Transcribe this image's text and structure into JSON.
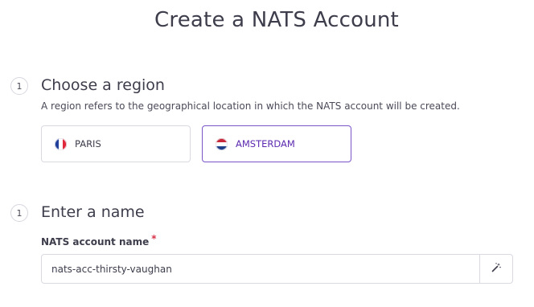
{
  "page": {
    "title": "Create a NATS Account"
  },
  "region_step": {
    "number": "1",
    "title": "Choose a region",
    "description": "A region refers to the geographical location in which the NATS account will be created.",
    "options": [
      {
        "label": "PARIS",
        "flag": "flag-france-icon",
        "selected": false
      },
      {
        "label": "AMSTERDAM",
        "flag": "flag-netherlands-icon",
        "selected": true
      }
    ]
  },
  "name_step": {
    "number": "1",
    "title": "Enter a name",
    "field_label": "NATS account name",
    "required_marker": "*",
    "value": "nats-acc-thirsty-vaughan",
    "generate_icon": "magic-wand-icon"
  },
  "colors": {
    "accent": "#7b54c9",
    "selected_text": "#5b2ab0",
    "required": "#d6334a",
    "border": "#d9d9e2"
  }
}
